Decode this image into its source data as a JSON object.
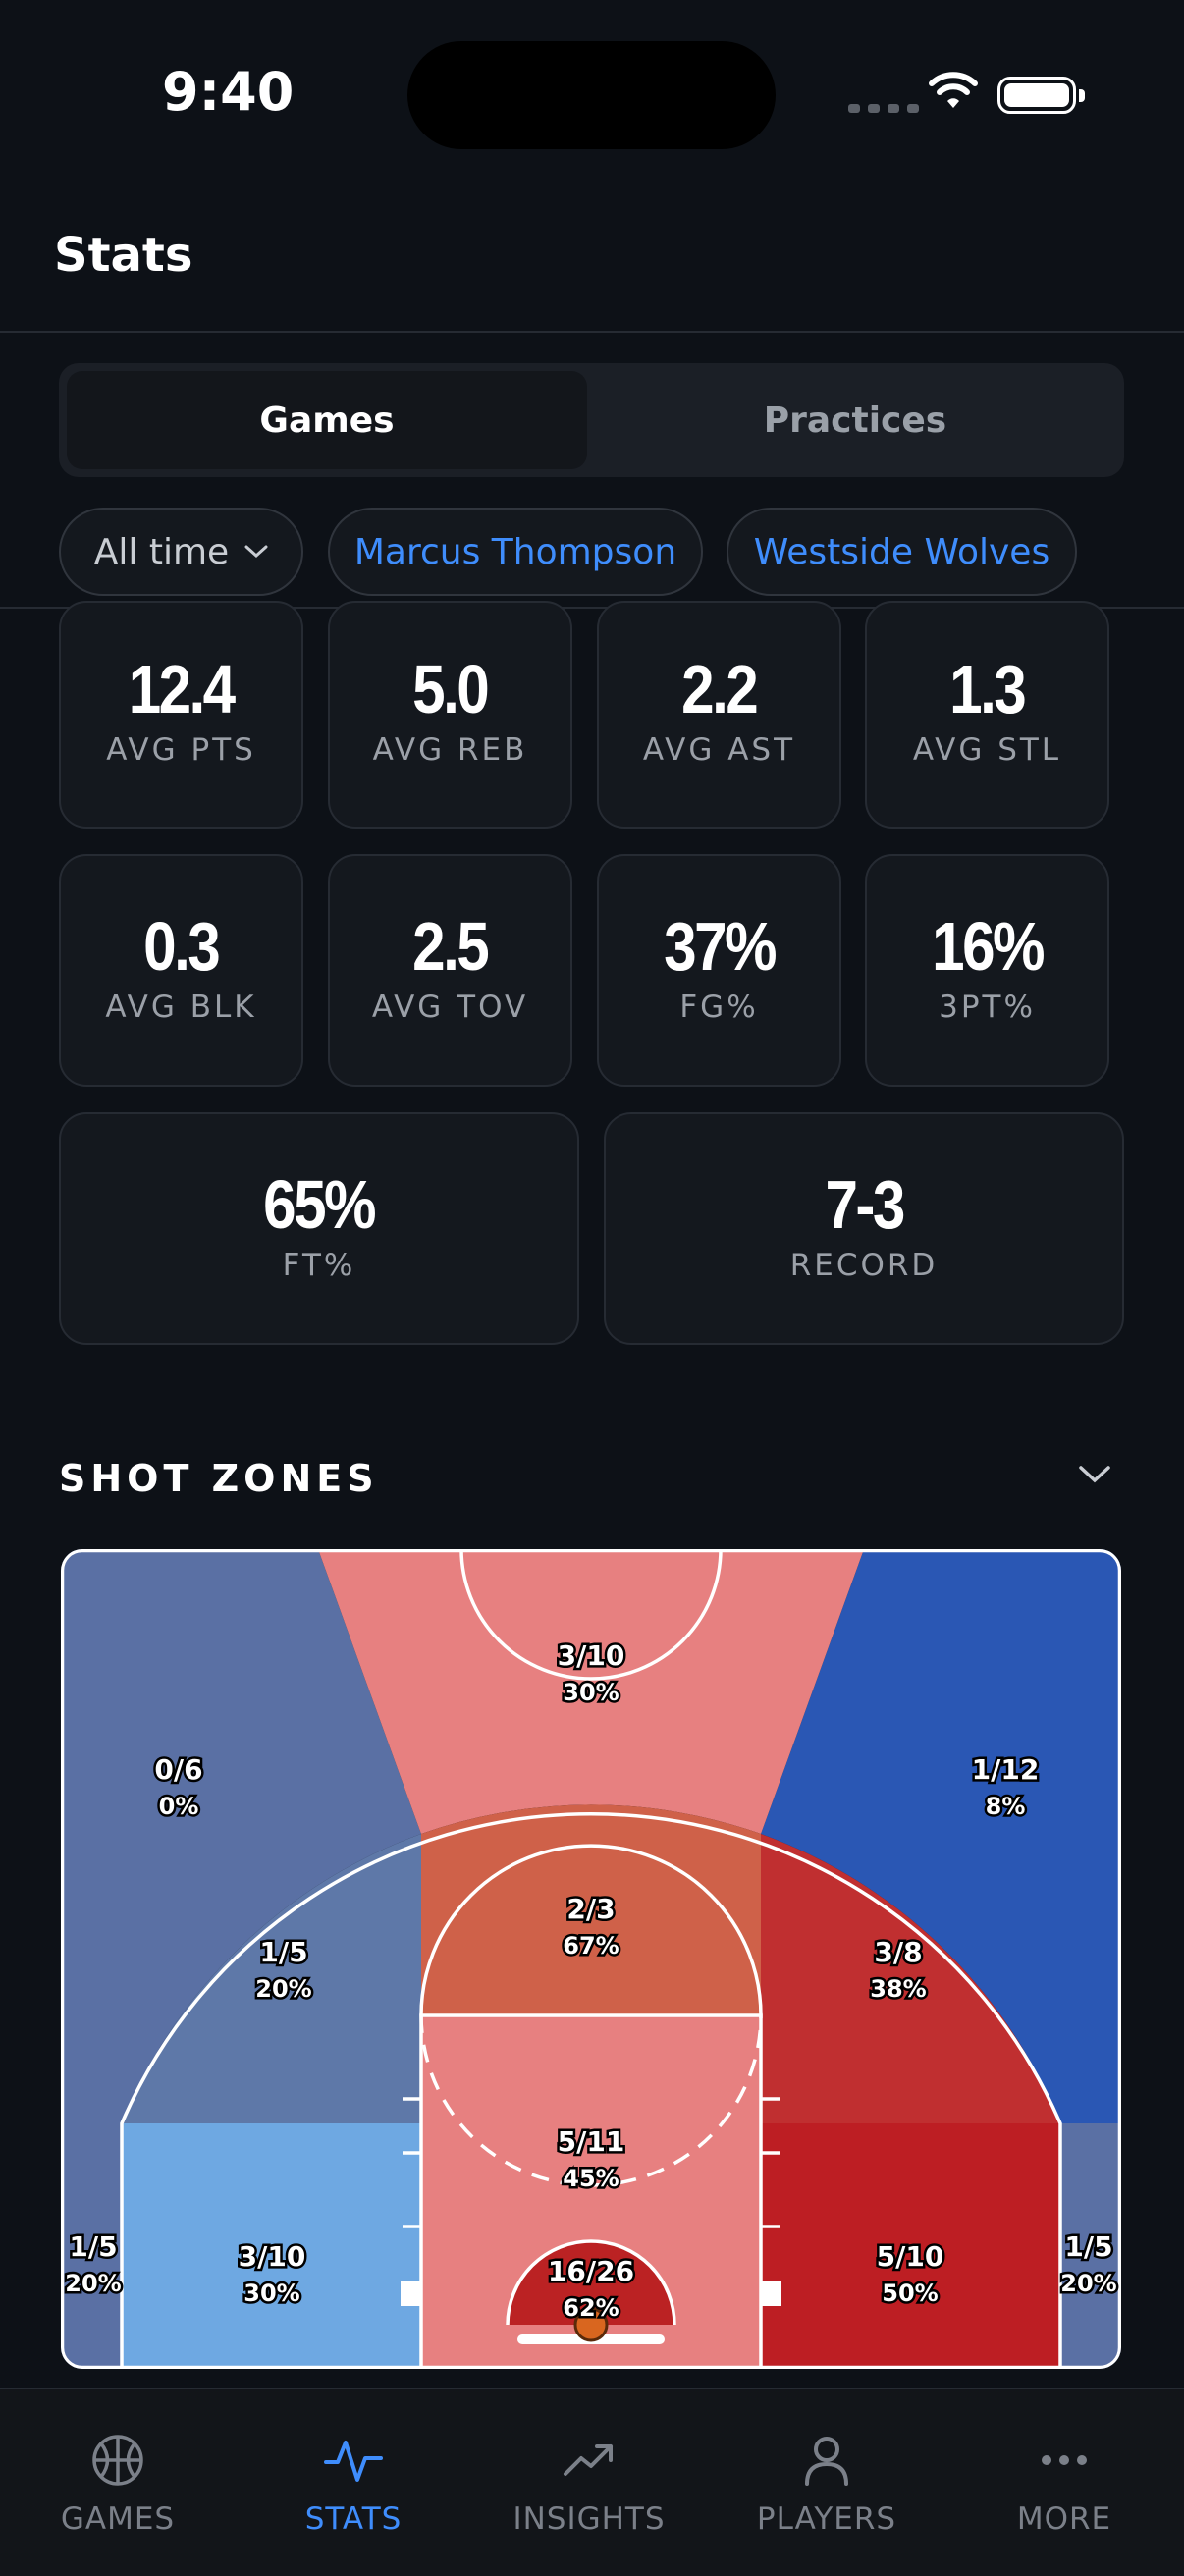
{
  "status_bar": {
    "time": "9:40"
  },
  "header": {
    "title": "Stats"
  },
  "segments": {
    "active": "Games",
    "inactive": "Practices"
  },
  "filters": {
    "time_range": "All time",
    "player": "Marcus Thompson",
    "team": "Westside Wolves"
  },
  "stats": [
    {
      "value": "12.4",
      "label": "AVG PTS"
    },
    {
      "value": "5.0",
      "label": "AVG REB"
    },
    {
      "value": "2.2",
      "label": "AVG AST"
    },
    {
      "value": "1.3",
      "label": "AVG STL"
    },
    {
      "value": "0.3",
      "label": "AVG BLK"
    },
    {
      "value": "2.5",
      "label": "AVG TOV"
    },
    {
      "value": "37%",
      "label": "FG%"
    },
    {
      "value": "16%",
      "label": "3PT%"
    },
    {
      "value": "65%",
      "label": "FT%"
    },
    {
      "value": "7-3",
      "label": "RECORD"
    }
  ],
  "shot_zones": {
    "title": "SHOT ZONES",
    "zones": [
      {
        "id": "top-key-three",
        "made_attempts": "3/10",
        "pct": "30%",
        "color": "#e78080"
      },
      {
        "id": "left-wing-three",
        "made_attempts": "0/6",
        "pct": "0%",
        "color": "#5a70a4"
      },
      {
        "id": "right-wing-three",
        "made_attempts": "1/12",
        "pct": "8%",
        "color": "#2a57b4"
      },
      {
        "id": "top-key-mid",
        "made_attempts": "2/3",
        "pct": "67%",
        "color": "#cf6149"
      },
      {
        "id": "left-elbow-mid",
        "made_attempts": "1/5",
        "pct": "20%",
        "color": "#5e78a8"
      },
      {
        "id": "right-elbow-mid",
        "made_attempts": "3/8",
        "pct": "38%",
        "color": "#c02f30"
      },
      {
        "id": "paint",
        "made_attempts": "5/11",
        "pct": "45%",
        "color": "#e78080"
      },
      {
        "id": "left-corner-three",
        "made_attempts": "1/5",
        "pct": "20%",
        "color": "#5a70a4"
      },
      {
        "id": "left-baseline-mid",
        "made_attempts": "3/10",
        "pct": "30%",
        "color": "#6ea8e2"
      },
      {
        "id": "restricted-area",
        "made_attempts": "16/26",
        "pct": "62%",
        "color": "#bb2223"
      },
      {
        "id": "right-baseline-mid",
        "made_attempts": "5/10",
        "pct": "50%",
        "color": "#bd1e23"
      },
      {
        "id": "right-corner-three",
        "made_attempts": "1/5",
        "pct": "20%",
        "color": "#5a70a4"
      }
    ]
  },
  "tabs": [
    {
      "label": "GAMES",
      "icon": "basketball-icon",
      "active": false
    },
    {
      "label": "STATS",
      "icon": "pulse-icon",
      "active": true
    },
    {
      "label": "INSIGHTS",
      "icon": "trending-up-icon",
      "active": false
    },
    {
      "label": "PLAYERS",
      "icon": "person-icon",
      "active": false
    },
    {
      "label": "MORE",
      "icon": "more-dots-icon",
      "active": false
    }
  ],
  "colors": {
    "accent": "#3f8dfc",
    "background": "#0d1117",
    "card": "#14181e"
  }
}
